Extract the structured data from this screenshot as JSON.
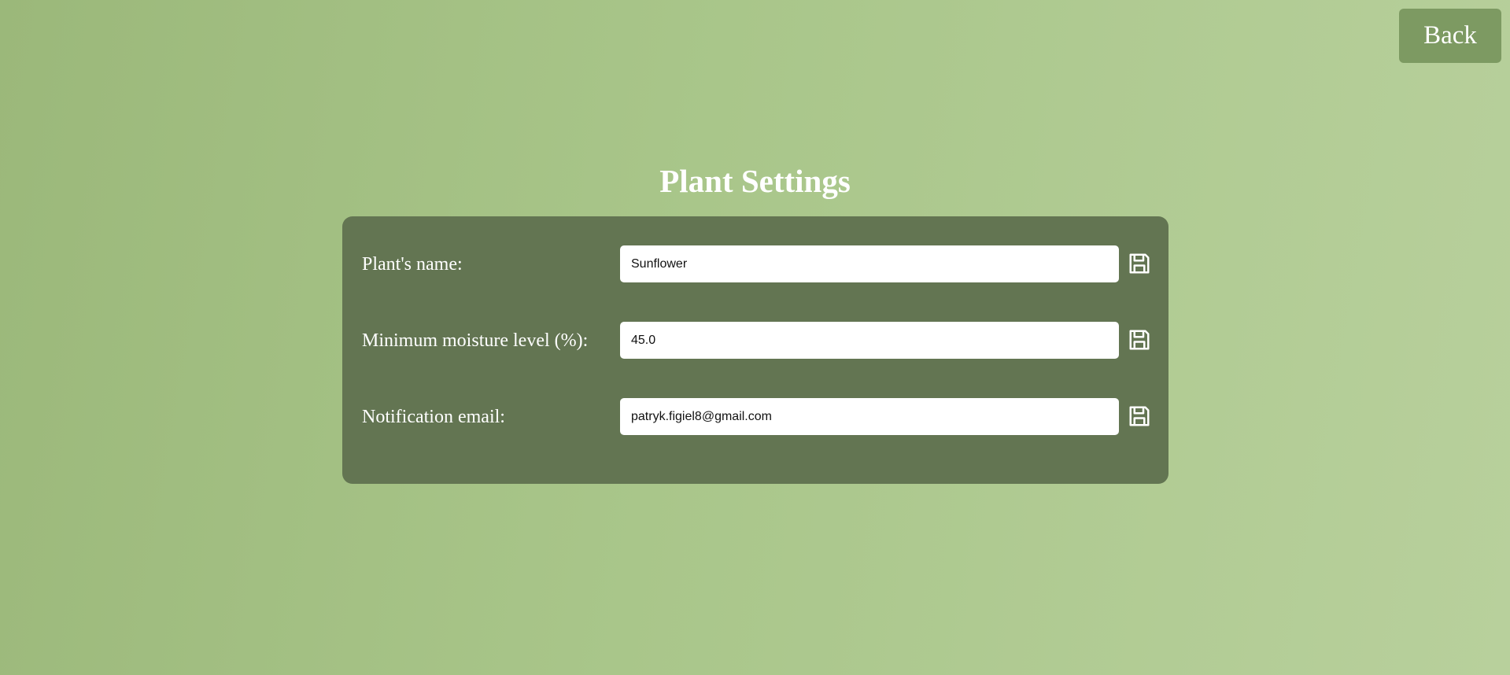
{
  "header": {
    "back_label": "Back"
  },
  "page": {
    "title": "Plant Settings"
  },
  "settings": {
    "plant_name": {
      "label": "Plant's name:",
      "value": "Sunflower",
      "save_icon": "save-icon"
    },
    "min_moisture": {
      "label": "Minimum moisture level (%):",
      "value": "45.0",
      "save_icon": "save-icon"
    },
    "notification_email": {
      "label": "Notification email:",
      "value": "patryk.figiel8@gmail.com",
      "save_icon": "save-icon"
    }
  },
  "colors": {
    "background_start": "#9bb87a",
    "background_end": "#b8d09c",
    "panel": "#637552",
    "back_button": "#7d9a62",
    "text": "#ffffff"
  }
}
